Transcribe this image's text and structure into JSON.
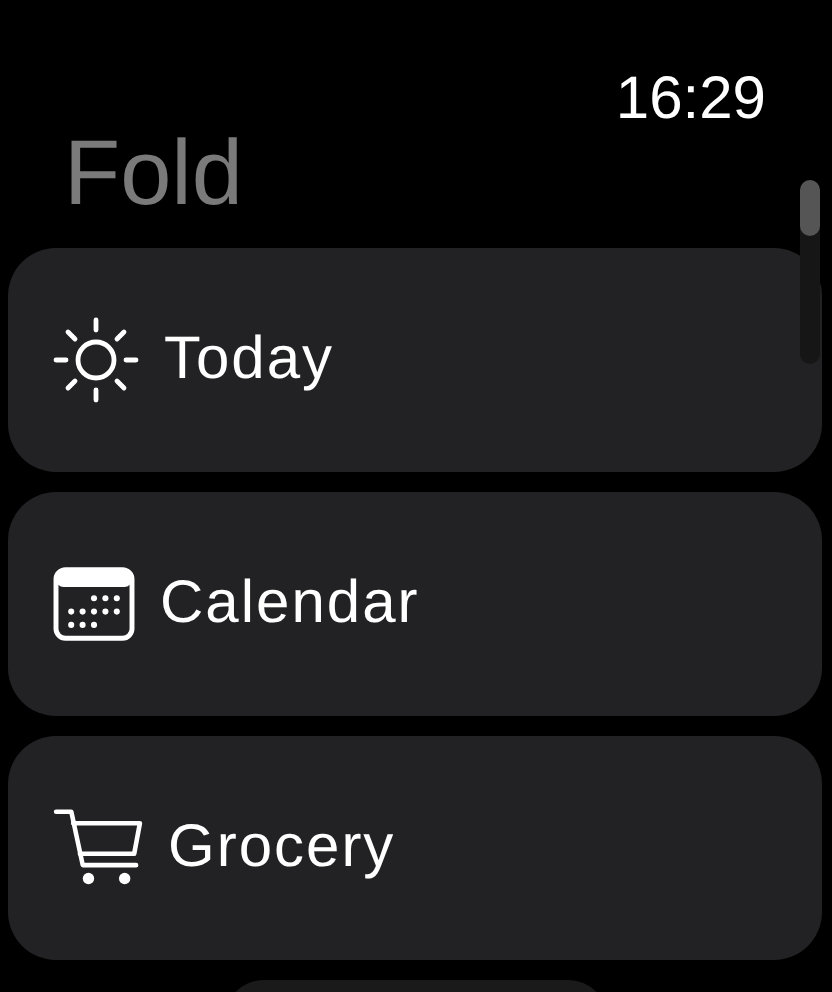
{
  "status_bar": {
    "time": "16:29"
  },
  "title": "Fold",
  "items": [
    {
      "label": "Today",
      "kind": "sun"
    },
    {
      "label": "Calendar",
      "kind": "calendar"
    },
    {
      "label": "Grocery",
      "kind": "cart"
    }
  ]
}
